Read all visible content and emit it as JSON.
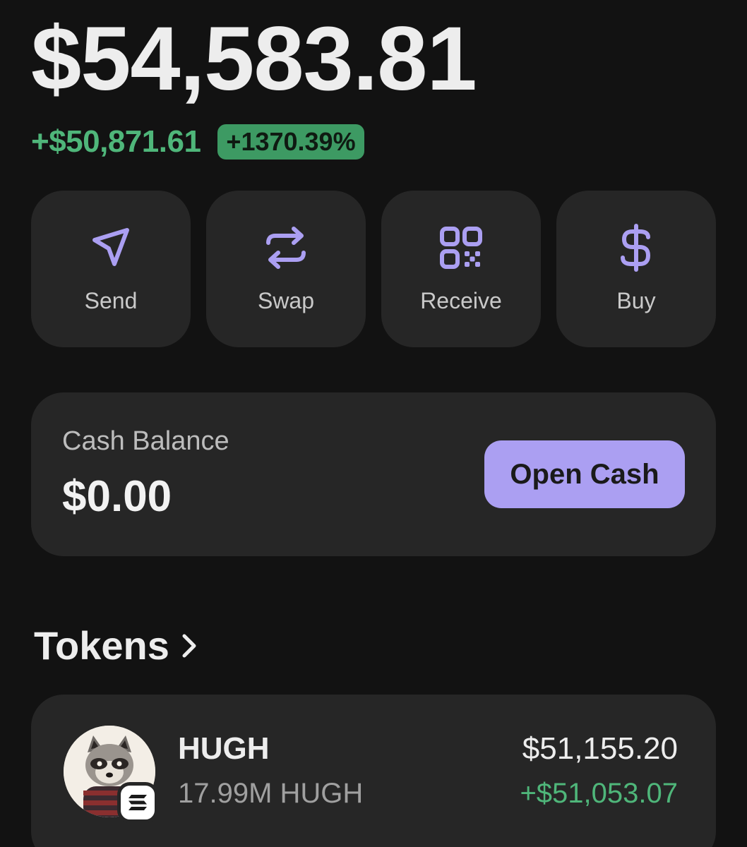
{
  "balance": {
    "total": "$54,583.81",
    "change_abs": "+$50,871.61",
    "change_pct": "+1370.39%"
  },
  "colors": {
    "accent": "#ab9ff2",
    "positive": "#4fb67a",
    "card": "#262626",
    "background": "#121212"
  },
  "actions": [
    {
      "label": "Send",
      "icon": "send-icon"
    },
    {
      "label": "Swap",
      "icon": "swap-icon"
    },
    {
      "label": "Receive",
      "icon": "qr-code-icon"
    },
    {
      "label": "Buy",
      "icon": "dollar-icon"
    }
  ],
  "cash": {
    "title": "Cash Balance",
    "value": "$0.00",
    "button_label": "Open Cash"
  },
  "tokens": {
    "title": "Tokens",
    "chevron_icon": "chevron-right-icon",
    "items": [
      {
        "name": "HUGH",
        "amount": "17.99M HUGH",
        "value": "$51,155.20",
        "change": "+$51,053.07",
        "avatar_icon": "raccoon-avatar",
        "chain_icon": "solana-icon"
      }
    ]
  }
}
